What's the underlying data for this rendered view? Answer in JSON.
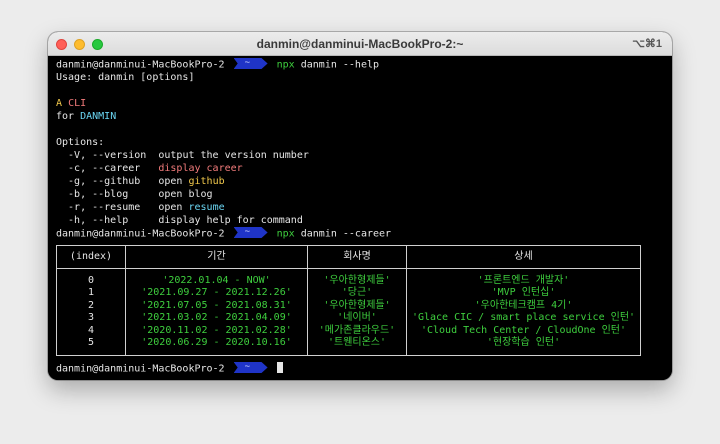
{
  "window": {
    "title": "danmin@danminui-MacBookPro-2:~",
    "shortcut": "⌥⌘1"
  },
  "colors": {
    "prompt_arrow": "#1f34c7",
    "command": "#3ecf3e",
    "career": "#f27b7b",
    "github": "#f2c94c",
    "resume": "#6ad5f2",
    "table_text": "#3ecf3e"
  },
  "prompt": {
    "host": "danmin@danminui-MacBookPro-2",
    "arrow_glyph": "~"
  },
  "commands": [
    {
      "cmd": "npx",
      "args": "danmin --help"
    },
    {
      "cmd": "npx",
      "args": "danmin --career"
    }
  ],
  "help": {
    "usage": "Usage: danmin [options]",
    "banner_a": "A",
    "banner_cli": "CLI",
    "banner_for": "for",
    "banner_name": "DANMIN",
    "options_title": "Options:",
    "options": [
      {
        "flags": "  -V, --version  ",
        "desc": "output the version number"
      },
      {
        "flags": "  -c, --career   ",
        "desc": "display career"
      },
      {
        "flags": "  -g, --github   ",
        "desc_open": "open",
        "desc_target": "github"
      },
      {
        "flags": "  -b, --blog     ",
        "desc": "open blog"
      },
      {
        "flags": "  -r, --resume   ",
        "desc_open": "open",
        "desc_target": "resume"
      },
      {
        "flags": "  -h, --help     ",
        "desc": "display help for command"
      }
    ]
  },
  "career_table": {
    "headers": [
      "(index)",
      "기간",
      "회사명",
      "상세"
    ],
    "rows": [
      {
        "index": "0",
        "period": "'2022.01.04 - NOW'",
        "company": "'우아한형제들'",
        "detail": "'프론트엔드 개발자'"
      },
      {
        "index": "1",
        "period": "'2021.09.27 - 2021.12.26'",
        "company": "'당근'",
        "detail": "'MVP 인턴십'"
      },
      {
        "index": "2",
        "period": "'2021.07.05 - 2021.08.31'",
        "company": "'우아한형제들'",
        "detail": "'우아한테크캠프 4기'"
      },
      {
        "index": "3",
        "period": "'2021.03.02 - 2021.04.09'",
        "company": "'네이버'",
        "detail": "'Glace CIC / smart place service 인턴'"
      },
      {
        "index": "4",
        "period": "'2020.11.02 - 2021.02.28'",
        "company": "'메가존클라우드'",
        "detail": "'Cloud Tech Center / CloudOne 인턴'"
      },
      {
        "index": "5",
        "period": "'2020.06.29 - 2020.10.16'",
        "company": "'트웬티온스'",
        "detail": "'현장학습 인턴'"
      }
    ]
  }
}
